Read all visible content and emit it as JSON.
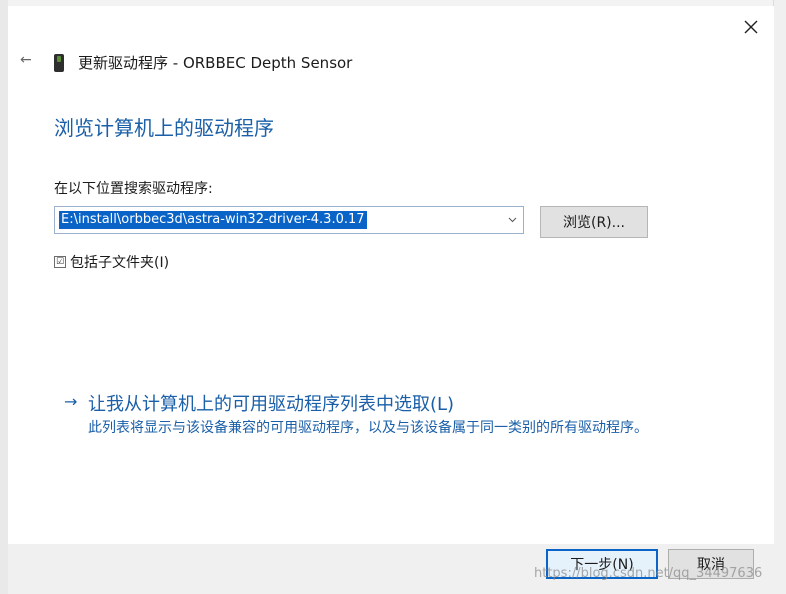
{
  "window": {
    "title": "更新驱动程序 - ORBBEC Depth Sensor",
    "back_icon": "←",
    "close_icon": "close-icon"
  },
  "main": {
    "heading": "浏览计算机上的驱动程序",
    "search_label": "在以下位置搜索驱动程序:",
    "path_value": "E:\\install\\orbbec3d\\astra-win32-driver-4.3.0.17",
    "dropdown_icon": "chevron-down-icon",
    "browse_label": "浏览(R)...",
    "include_subfolders": {
      "checked": true,
      "check_mark": "☑",
      "label": "包括子文件夹(I)"
    },
    "pick_from_list": {
      "arrow": "→",
      "title": "让我从计算机上的可用驱动程序列表中选取(L)",
      "description": "此列表将显示与该设备兼容的可用驱动程序，以及与该设备属于同一类别的所有驱动程序。"
    }
  },
  "footer": {
    "next_label": "下一步(N)",
    "cancel_label": "取消"
  },
  "watermark": "https://blog.csdn.net/qq_34497636",
  "colors": {
    "accent": "#1a5fa8",
    "selection": "#0a64c8",
    "footer_bg": "#f0f0f0"
  }
}
